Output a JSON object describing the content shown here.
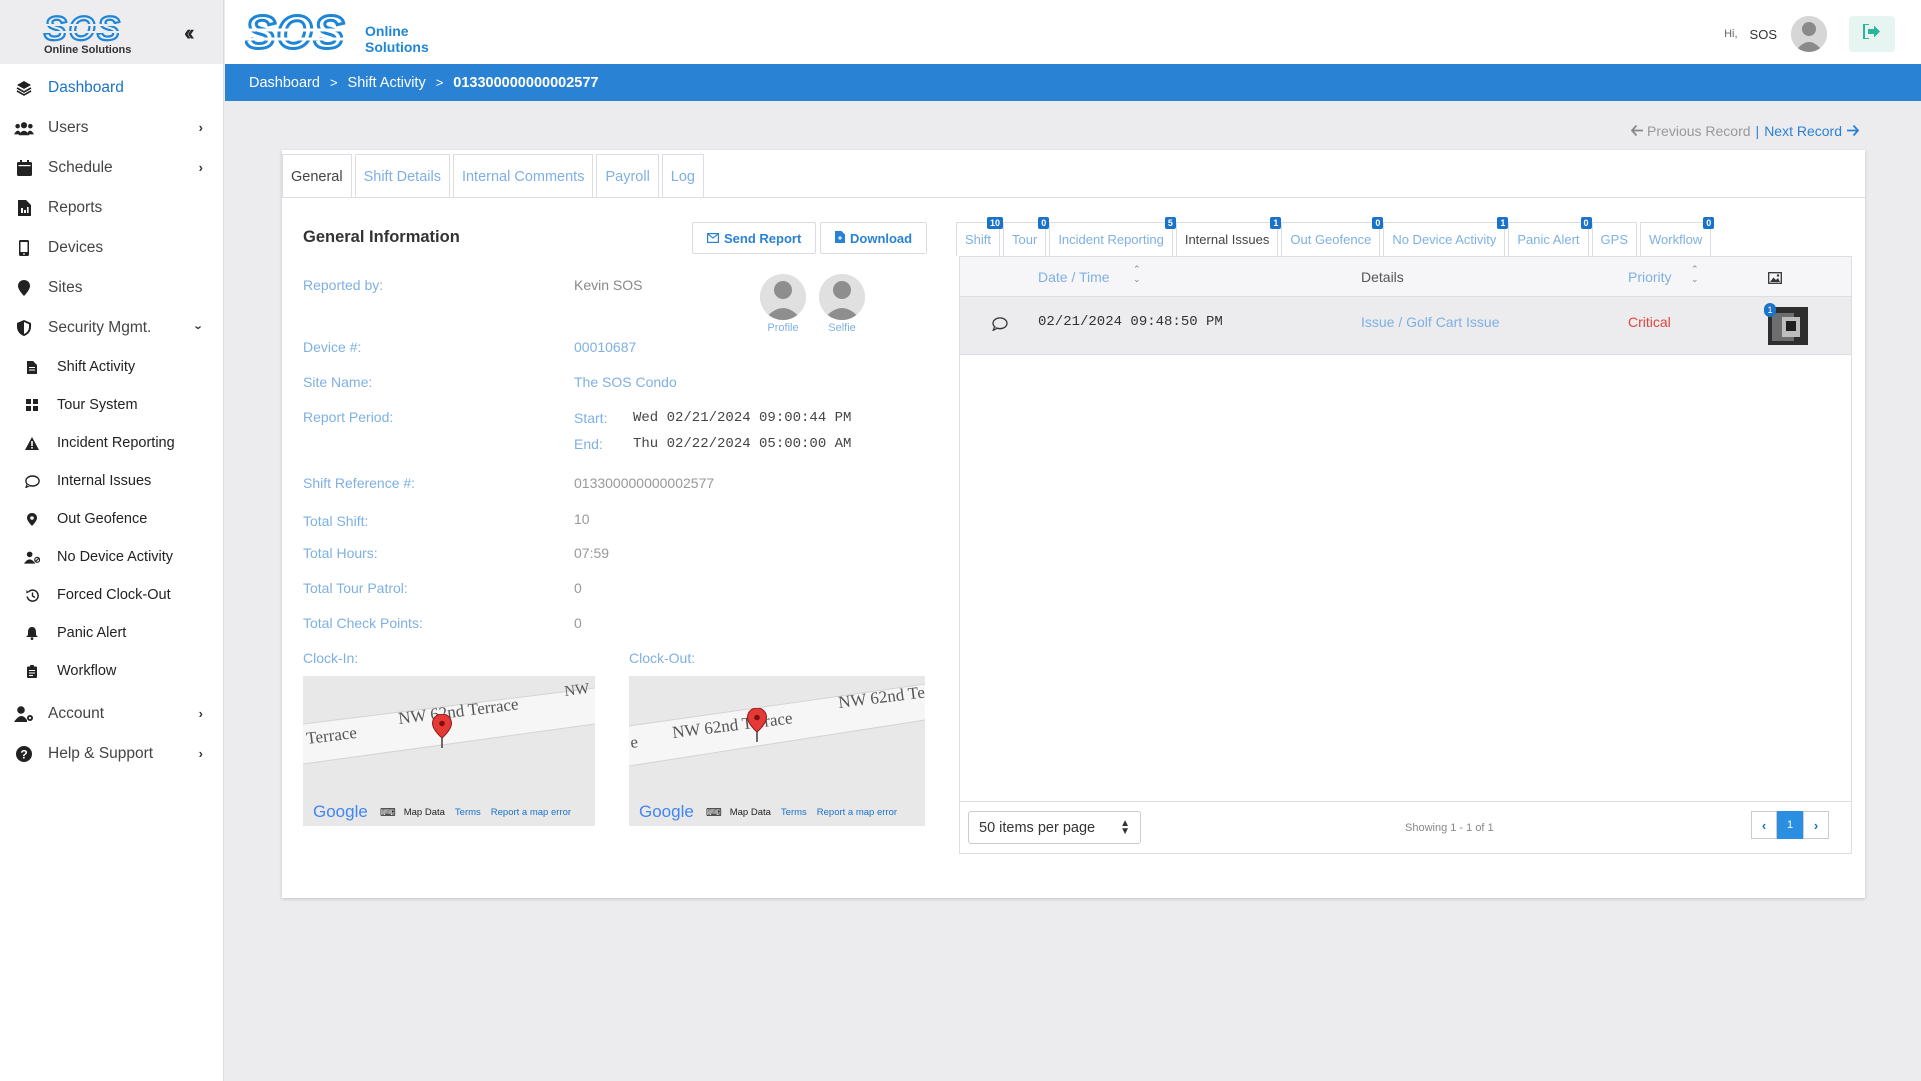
{
  "brand": {
    "logo_text": "SOS",
    "logo_sub": "Online Solutions",
    "logo_line1": "Online",
    "logo_line2": "Solutions"
  },
  "sidebar": {
    "items": [
      {
        "label": "Dashboard",
        "icon": "layers-icon"
      },
      {
        "label": "Users",
        "icon": "users-icon"
      },
      {
        "label": "Schedule",
        "icon": "calendar-icon"
      },
      {
        "label": "Reports",
        "icon": "report-file-icon"
      },
      {
        "label": "Devices",
        "icon": "mobile-device-icon"
      },
      {
        "label": "Sites",
        "icon": "map-pin-icon"
      },
      {
        "label": "Security Mgmt.",
        "icon": "shield-icon"
      }
    ],
    "sub_items": [
      {
        "label": "Shift Activity",
        "icon": "document-icon"
      },
      {
        "label": "Tour System",
        "icon": "grid-icon"
      },
      {
        "label": "Incident Reporting",
        "icon": "warning-icon"
      },
      {
        "label": "Internal Issues",
        "icon": "comment-icon"
      },
      {
        "label": "Out Geofence",
        "icon": "pin-icon"
      },
      {
        "label": "No Device Activity",
        "icon": "user-slash-icon"
      },
      {
        "label": "Forced Clock-Out",
        "icon": "history-icon"
      },
      {
        "label": "Panic Alert",
        "icon": "bell-icon"
      },
      {
        "label": "Workflow",
        "icon": "clipboard-icon"
      }
    ],
    "bottom_items": [
      {
        "label": "Account",
        "icon": "user-cog-icon"
      },
      {
        "label": "Help & Support",
        "icon": "question-circle-icon"
      }
    ]
  },
  "topbar": {
    "hi": "Hi,",
    "user": "SOS"
  },
  "breadcrumb": {
    "home": "Dashboard",
    "section": "Shift Activity",
    "current": "013300000000002577"
  },
  "record_nav": {
    "prev": "Previous Record",
    "sep": "|",
    "next": "Next Record"
  },
  "tabs": [
    "General",
    "Shift Details",
    "Internal Comments",
    "Payroll",
    "Log"
  ],
  "general": {
    "title": "General Information",
    "send_report": "Send Report",
    "download": "Download",
    "reported_by_label": "Reported by:",
    "reported_by": "Kevin SOS",
    "profile_caption": "Profile",
    "selfie_caption": "Selfie",
    "device_label": "Device #:",
    "device": "00010687",
    "site_label": "Site Name:",
    "site": "The SOS Condo",
    "period_label": "Report Period:",
    "start_label": "Start:",
    "start": "Wed 02/21/2024 09:00:44 PM",
    "end_label": "End:",
    "end": "Thu 02/22/2024 05:00:00 AM",
    "shift_ref_label": "Shift Reference #:",
    "shift_ref": "013300000000002577",
    "total_shift_label": "Total Shift:",
    "total_shift": "10",
    "total_hours_label": "Total Hours:",
    "total_hours": "07:59",
    "tour_patrol_label": "Total Tour Patrol:",
    "tour_patrol": "0",
    "check_points_label": "Total Check Points:",
    "check_points": "0",
    "clock_in_label": "Clock-In:",
    "clock_out_label": "Clock-Out:"
  },
  "maps": {
    "in": {
      "streets": [
        "Terrace",
        "NW 62nd Terrace",
        "NW"
      ]
    },
    "out": {
      "streets": [
        "e",
        "NW 62nd Terrace",
        "NW 62nd Te"
      ]
    },
    "google": "Google",
    "map_data": "Map Data",
    "terms": "Terms",
    "report": "Report a map error"
  },
  "right_tabs": [
    {
      "label": "Shift",
      "count": "10"
    },
    {
      "label": "Tour",
      "count": "0"
    },
    {
      "label": "Incident Reporting",
      "count": "5"
    },
    {
      "label": "Internal Issues",
      "count": "1"
    },
    {
      "label": "Out Geofence",
      "count": "0"
    },
    {
      "label": "No Device Activity",
      "count": "1"
    },
    {
      "label": "Panic Alert",
      "count": "0"
    },
    {
      "label": "GPS",
      "count": ""
    },
    {
      "label": "Workflow",
      "count": "0"
    }
  ],
  "grid": {
    "col_datetime": "Date / Time",
    "col_details": "Details",
    "col_priority": "Priority",
    "rows": [
      {
        "datetime": "02/21/2024 09:48:50 PM",
        "details": "Issue / Golf Cart Issue",
        "priority": "Critical",
        "img_count": "1"
      }
    ],
    "items_per_page": "50 items per page",
    "showing": "Showing 1 - 1 of 1",
    "page": "1"
  },
  "colors": {
    "accent": "#2a82d4",
    "critical": "#e0443e",
    "link": "#7fb0e3"
  }
}
